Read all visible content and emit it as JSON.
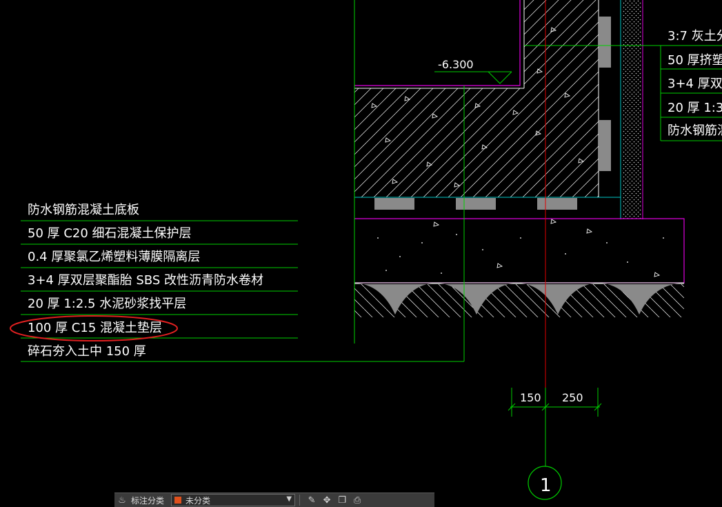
{
  "drawing": {
    "elevation_label": "-6.300",
    "left_layers": [
      "防水钢筋混凝土底板",
      "50 厚 C20  细石混凝土保护层",
      "0.4  厚聚氯乙烯塑料薄膜隔离层",
      "3+4  厚双层聚酯胎    SBS 改性沥青防水卷材",
      "20 厚 1:2.5   水泥砂浆找平层",
      "100  厚 C15  混凝土垫层",
      "碎石夯入土中    150  厚"
    ],
    "right_layers": [
      "3:7  灰土分",
      "50  厚挤塑",
      "3+4  厚双",
      "20  厚 1:3",
      "防水钢筋混"
    ],
    "dimensions": [
      "150",
      "250"
    ],
    "axis_label": "1",
    "highlighted_layer": "100  厚 C15  混凝土垫层"
  },
  "toolbar": {
    "annotation_label": "标注分类",
    "category_value": "未分类",
    "category_color": "#e0501c"
  },
  "colors": {
    "background": "#000000",
    "leader_line": "#00d000",
    "outline_magenta": "#e000e0",
    "axis_red": "#e00000",
    "text_white": "#ffffff",
    "highlight_ellipse": "#e02020",
    "bar_gray": "#8a8a8a"
  }
}
